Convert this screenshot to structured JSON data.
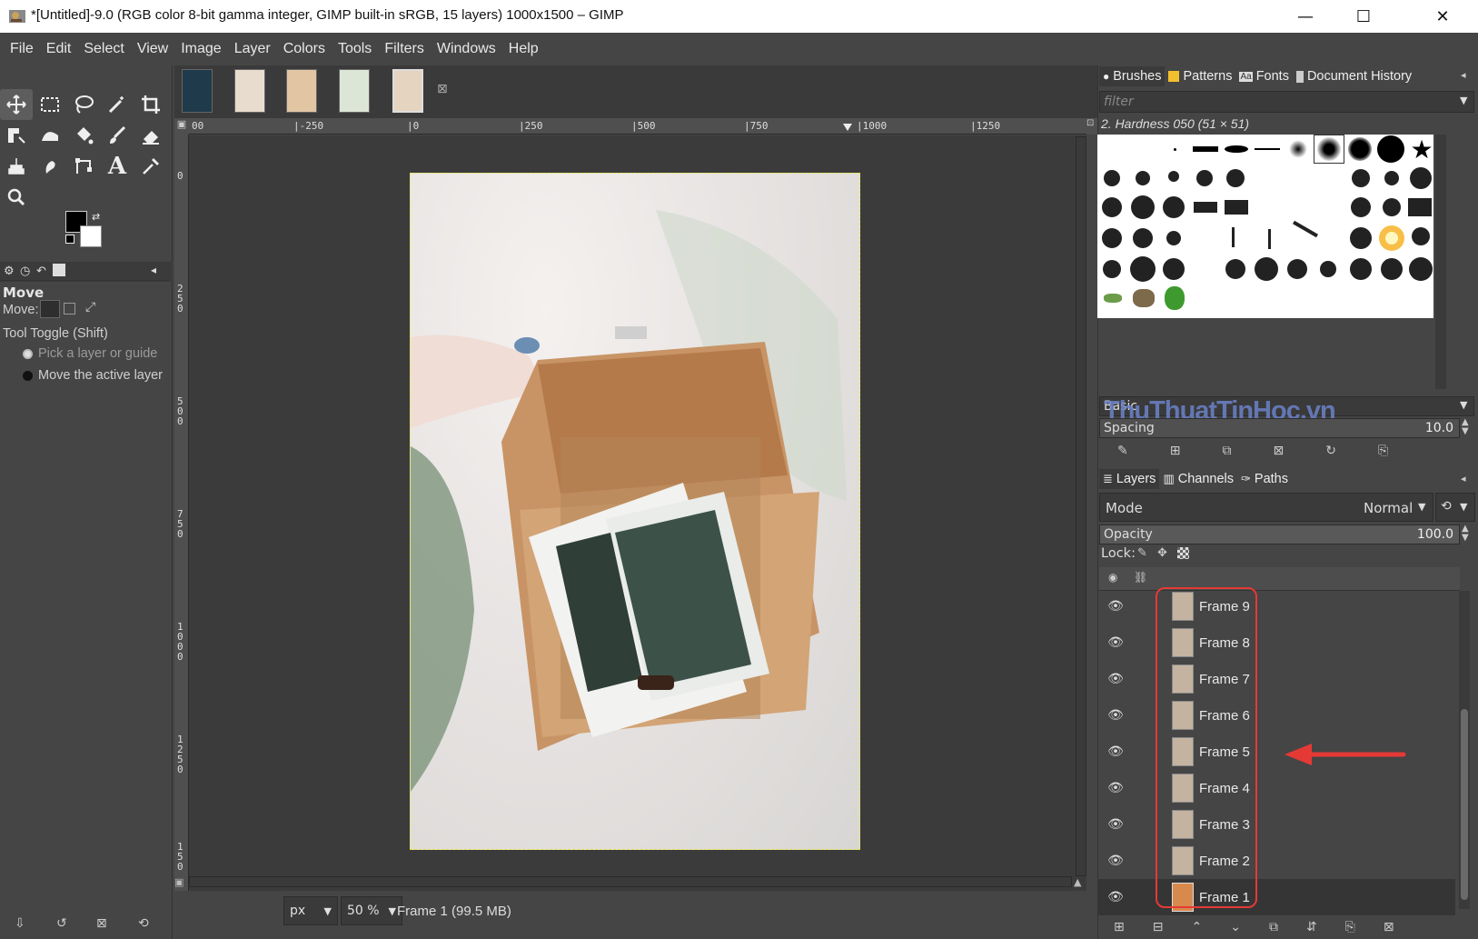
{
  "window": {
    "title": "*[Untitled]-9.0 (RGB color 8-bit gamma integer, GIMP built-in sRGB, 15 layers) 1000x1500 – GIMP",
    "minimize": "—",
    "maximize": "☐",
    "close": "✕"
  },
  "menu": [
    "File",
    "Edit",
    "Select",
    "View",
    "Image",
    "Layer",
    "Colors",
    "Tools",
    "Filters",
    "Windows",
    "Help"
  ],
  "tool_options": {
    "title": "Move",
    "move_label": "Move:",
    "toggle_label": "Tool Toggle  (Shift)",
    "option_pick": "Pick a layer or guide",
    "option_move": "Move the active layer"
  },
  "ruler": {
    "h_ticks": [
      "|-250",
      "|0",
      "|250",
      "|500",
      "|750",
      "|1000",
      "|1250"
    ],
    "h_start": "00",
    "v_ticks": [
      "0",
      "2\n5\n0",
      "5\n0\n0",
      "7\n5\n0",
      "1\n0\n0\n0",
      "1\n2\n5\n0",
      "1\n5\n0"
    ]
  },
  "status": {
    "unit": "px",
    "zoom": "50 %",
    "info": "Frame 1 (99.5 MB)"
  },
  "brushes_dock": {
    "tabs": [
      "Brushes",
      "Patterns",
      "Fonts",
      "Document History"
    ],
    "filter_placeholder": "filter",
    "selected_brush": "2. Hardness 050 (51 × 51)",
    "preset_label": "Basic",
    "spacing_label": "Spacing",
    "spacing_value": "10.0"
  },
  "layers_dock": {
    "tabs": [
      "Layers",
      "Channels",
      "Paths"
    ],
    "mode_label": "Mode",
    "mode_value": "Normal",
    "opacity_label": "Opacity",
    "opacity_value": "100.0",
    "lock_label": "Lock:",
    "layers": [
      "Frame 9",
      "Frame 8",
      "Frame 7",
      "Frame 6",
      "Frame 5",
      "Frame 4",
      "Frame 3",
      "Frame 2",
      "Frame 1"
    ],
    "active_layer": "Frame 1"
  },
  "watermark": "ThuThuatTinHoc.vn",
  "colors": {
    "annotation_red": "#e53935",
    "bg": "#454545",
    "selection": "#e8e84a"
  }
}
